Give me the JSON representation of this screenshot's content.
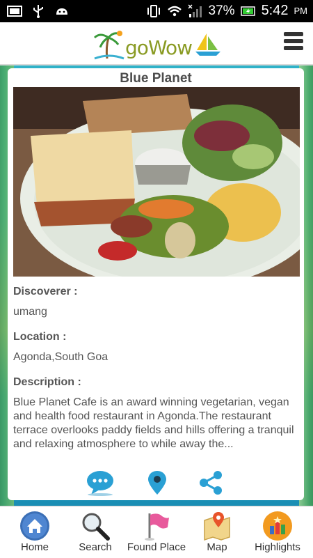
{
  "status_bar": {
    "battery_percent": "37%",
    "time": "5:42",
    "ampm": "PM"
  },
  "header": {
    "logo_text": "goWow"
  },
  "place": {
    "title": "Blue Planet",
    "discoverer_label": "Discoverer :",
    "discoverer_value": "umang",
    "location_label": "Location :",
    "location_value": "Agonda,South Goa",
    "description_label": "Description :",
    "description_value": "Blue Planet Cafe is an award winning vegetarian, vegan and health food restaurant in Agonda.The restaurant terrace overlooks paddy fields and hills offering a tranquil and relaxing atmosphere to while away the..."
  },
  "actions": {
    "comment_icon": "chat-bubble-icon",
    "location_icon": "map-pin-icon",
    "share_icon": "share-icon"
  },
  "bottom_nav": [
    {
      "label": "Home",
      "icon": "home-icon"
    },
    {
      "label": "Search",
      "icon": "magnifier-icon"
    },
    {
      "label": "Found Place",
      "icon": "flag-icon"
    },
    {
      "label": "Map",
      "icon": "map-icon"
    },
    {
      "label": "Highlights",
      "icon": "highlights-icon"
    }
  ],
  "colors": {
    "accent_blue": "#2aa0d4",
    "logo_green": "#8a9b24"
  }
}
